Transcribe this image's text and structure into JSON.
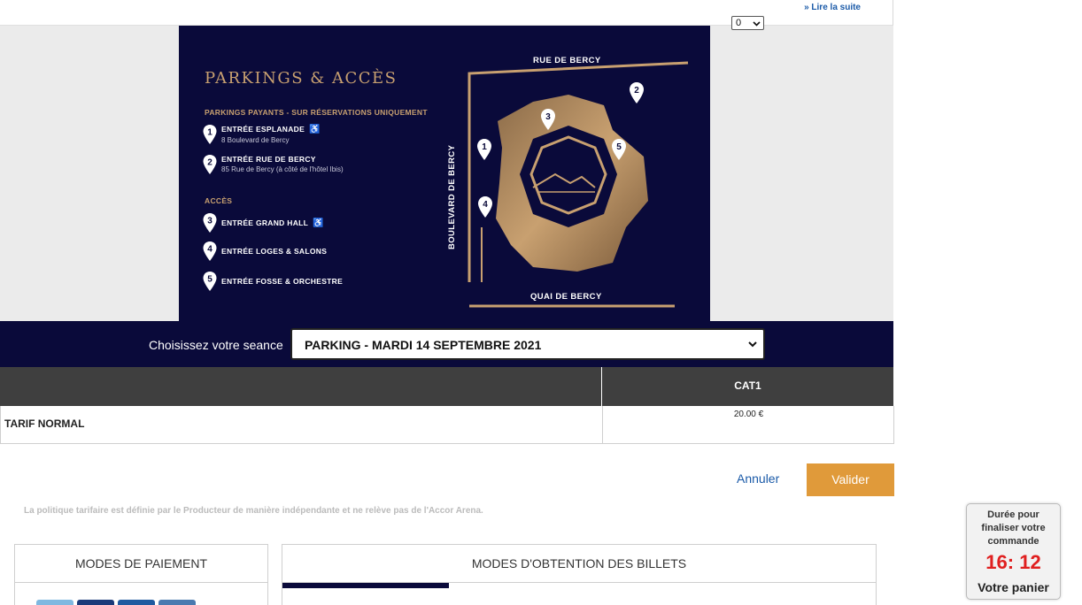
{
  "header": {
    "read_more": "» Lire la suite"
  },
  "banner": {
    "title": "PARKINGS & ACCÈS",
    "parkings_heading": "PARKINGS PAYANTS - SUR RÉSERVATIONS UNIQUEMENT",
    "parkings": [
      {
        "number": "1",
        "name": "ENTRÉE ESPLANADE",
        "address": "8 Boulevard de Bercy",
        "accessible": true
      },
      {
        "number": "2",
        "name": "ENTRÉE RUE DE BERCY",
        "address": "85 Rue de Bercy (à côté de l'hôtel Ibis)",
        "accessible": false
      }
    ],
    "access_heading": "ACCÈS",
    "access": [
      {
        "number": "3",
        "name": "ENTRÉE GRAND HALL",
        "accessible": true
      },
      {
        "number": "4",
        "name": "ENTRÉE LOGES & SALONS",
        "accessible": false
      },
      {
        "number": "5",
        "name": "ENTRÉE FOSSE & ORCHESTRE",
        "accessible": false
      }
    ],
    "accessible_icon": "wheelchair-icon",
    "map_pins": [
      "1",
      "2",
      "3",
      "4",
      "5"
    ],
    "streets": {
      "top": "RUE DE BERCY",
      "left": "BOULEVARD DE BERCY",
      "bottom": "QUAI DE BERCY"
    }
  },
  "seance": {
    "label": "Choisissez votre seance",
    "selected": "PARKING - MARDI 14 SEPTEMBRE 2021"
  },
  "pricing_table": {
    "columns": [
      "",
      "CAT1"
    ],
    "rows": [
      {
        "tarif": "TARIF NORMAL",
        "price": "20.00 €",
        "quantity": "0"
      }
    ]
  },
  "actions": {
    "cancel": "Annuler",
    "validate": "Valider"
  },
  "policy_text": "La politique tarifaire est définie par le Producteur de manière indépendante et ne relève pas de l'Accor Arena.",
  "panels": {
    "payment_title": "MODES DE PAIEMENT",
    "delivery_title": "MODES D'OBTENTION DES BILLETS"
  },
  "timer": {
    "label": "Durée pour finaliser votre commande",
    "time": "16: 12",
    "cart": "Votre panier"
  },
  "colors": {
    "navy": "#0a0a3a",
    "gold": "#c8a070",
    "validate": "#e09a3a",
    "link": "#1a5aa8",
    "timer_red": "#e02020"
  }
}
